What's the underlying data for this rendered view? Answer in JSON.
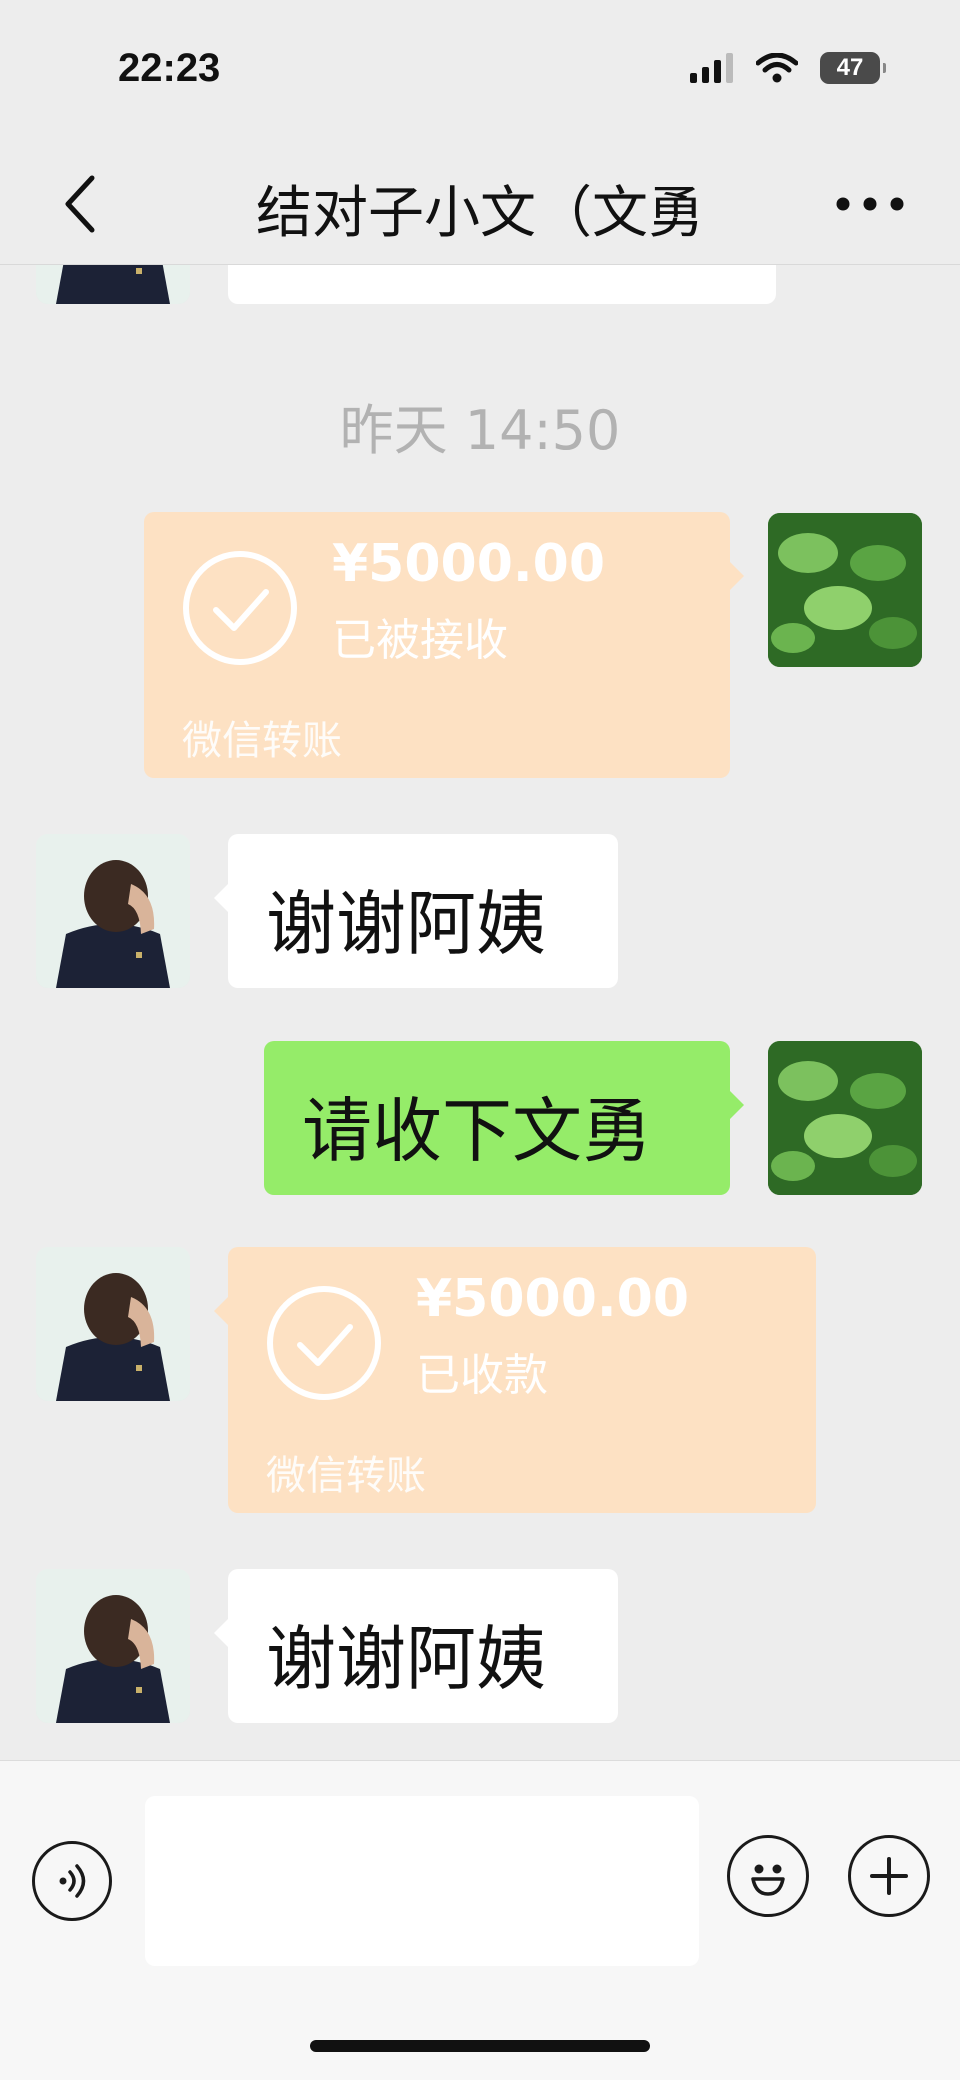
{
  "status_bar": {
    "time": "22:23",
    "battery": "47"
  },
  "nav": {
    "title": "结对子小文（文勇"
  },
  "messages": [
    {
      "type": "timestamp",
      "text": "昨天 14:50"
    },
    {
      "type": "transfer",
      "side": "right",
      "amount": "¥5000.00",
      "status": "已被接收",
      "footer": "微信转账"
    },
    {
      "type": "text",
      "side": "left",
      "text": "谢谢阿姨"
    },
    {
      "type": "text",
      "side": "right",
      "text": "请收下文勇"
    },
    {
      "type": "transfer",
      "side": "left",
      "amount": "¥5000.00",
      "status": "已收款",
      "footer": "微信转账"
    },
    {
      "type": "text",
      "side": "left",
      "text": "谢谢阿姨"
    }
  ],
  "input": {
    "value": ""
  },
  "colors": {
    "self_bubble": "#95ec69",
    "transfer_bubble": "#fde1c3",
    "background": "#ededed"
  },
  "icons": [
    "back-icon",
    "more-icon",
    "voice-icon",
    "emoji-icon",
    "plus-icon"
  ]
}
